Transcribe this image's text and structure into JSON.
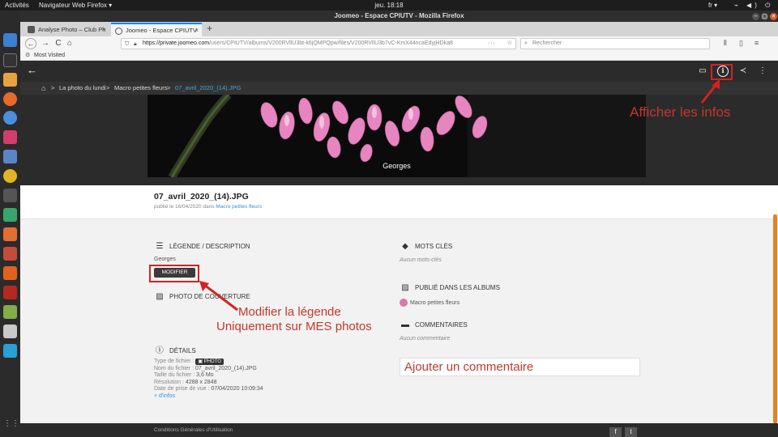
{
  "desktop": {
    "activities": "Activités",
    "app_menu": "Navigateur Web Firefox ▾",
    "clock": "jeu. 18:18",
    "language": "fr ▾",
    "system_icons": "⌁ ◀) ⏻ ▾"
  },
  "window": {
    "title": "Joomeo - Espace CPIUTV - Mozilla Firefox",
    "minimize": "–",
    "maximize": "▢",
    "close": "×"
  },
  "tabs": [
    {
      "label": "Analyse Photo – Club Ph",
      "close": "×"
    },
    {
      "label": "Joomeo - Espace CPIUTV",
      "close": "×"
    }
  ],
  "new_tab": "+",
  "nav": {
    "back": "←",
    "forward": "→",
    "reload": "C",
    "home": "⌂",
    "url_host": "https://private.joomeo.com",
    "url_path": "/users/CPIUTV/albums/V200RVllU3bt-k6jQMPQpw/files/V200RVllU3b7vC-KmX44ncaEdyjHDka8",
    "url_more": "···",
    "bookmark_star": "☆",
    "search_placeholder": "Rechercher",
    "library": "⫴",
    "sidebar": "▯",
    "menu": "≡"
  },
  "bookmarks": {
    "most_visited": "Most Visited"
  },
  "breadcrumb": {
    "sep": ">",
    "items": [
      "La photo du lundi",
      "Macro petites fleurs"
    ],
    "current": "07_avril_2020_(14).JPG"
  },
  "viewer_icons": {
    "back": "←",
    "slideshow": "▭",
    "info": "i",
    "share": "≺",
    "more": "⋮"
  },
  "photo": {
    "caption": "Georges"
  },
  "file": {
    "title": "07_avril_2020_(14).JPG",
    "published_prefix": "publié le 16/04/2020 dans",
    "album_link": "Macro petites fleurs"
  },
  "legend": {
    "heading": "LÉGENDE / DESCRIPTION",
    "text": "Georges",
    "modify_button": "MODIFIER"
  },
  "cover": {
    "heading": "PHOTO DE COUVERTURE"
  },
  "details": {
    "heading": "DÉTAILS",
    "type_label": "Type de fichier :",
    "type_badge": "▣ PHOTO",
    "name_label": "Nom du fichier :",
    "name_value": "07_avril_2020_(14).JPG",
    "size_label": "Taille du fichier :",
    "size_value": "3,6 Mo",
    "res_label": "Résolution :",
    "res_value": "4288 x 2848",
    "date_label": "Date de prise de vue :",
    "date_value": "07/04/2020 10:09:34",
    "more_link": "+ d'infos"
  },
  "keywords": {
    "heading": "MOTS CLÉS",
    "empty": "Aucun mots-clés"
  },
  "albums": {
    "heading": "PUBLIÉ DANS LES ALBUMS",
    "item": "Macro petites fleurs"
  },
  "comments": {
    "heading": "COMMENTAIRES",
    "empty": "Aucun commentaire"
  },
  "annotations": {
    "info": "Afficher les infos",
    "legend_line1": "Modifier la légende",
    "legend_line2": "Uniquement sur MES photos",
    "comment": "Ajouter un commentaire"
  },
  "footer": {
    "cgu": "Conditions Générales d'Utilisation",
    "facebook": "f",
    "twitter": "t"
  },
  "colors": {
    "annotation_red": "#c0392b",
    "link_blue": "#3a8fd1",
    "dark_bar": "#2b2b2b",
    "flower_pink": "#e785c0"
  }
}
